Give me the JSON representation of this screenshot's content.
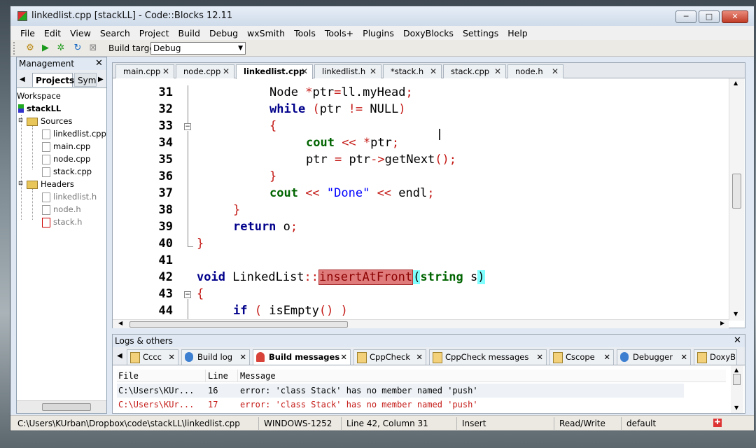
{
  "window": {
    "title": "linkedlist.cpp [stackLL] - Code::Blocks 12.11",
    "minimize": "─",
    "maximize": "□",
    "close": "✕"
  },
  "menu": [
    "File",
    "Edit",
    "View",
    "Search",
    "Project",
    "Build",
    "Debug",
    "wxSmith",
    "Tools",
    "Tools+",
    "Plugins",
    "DoxyBlocks",
    "Settings",
    "Help"
  ],
  "toolbar": {
    "build_target_label": "Build target:",
    "build_target_value": "Debug"
  },
  "management": {
    "title": "Management",
    "tabs": [
      "Projects",
      "Sym"
    ],
    "workspace": "Workspace",
    "project": "stackLL",
    "sources_folder": "Sources",
    "sources": [
      "linkedlist.cpp",
      "main.cpp",
      "node.cpp",
      "stack.cpp"
    ],
    "headers_folder": "Headers",
    "headers": [
      "linkedlist.h",
      "node.h",
      "stack.h"
    ]
  },
  "editor": {
    "tabs": [
      "main.cpp",
      "node.cpp",
      "linkedlist.cpp",
      "linkedlist.h",
      "*stack.h",
      "stack.cpp",
      "node.h"
    ],
    "active_tab": "linkedlist.cpp",
    "line_numbers": [
      "31",
      "32",
      "33",
      "34",
      "35",
      "36",
      "37",
      "38",
      "39",
      "40",
      "41",
      "42",
      "43",
      "44"
    ],
    "code": {
      "l31_a": "Node ",
      "l31_b": "*",
      "l31_c": "ptr",
      "l31_d": "=",
      "l31_e": "ll.myHead",
      "l31_f": ";",
      "l32_kw": "while",
      "l32_b": " ",
      "l32_p1": "(",
      "l32_c": "ptr ",
      "l32_op": "!=",
      "l32_d": " NULL",
      "l32_p2": ")",
      "l33": "{",
      "l34_kw": "cout",
      "l34_op": " << *",
      "l34_c": "ptr",
      "l34_s": ";",
      "l35_a": "ptr ",
      "l35_op": "=",
      "l35_b": " ptr",
      "l35_op2": "->",
      "l35_c": "getNext",
      "l35_d": "();",
      "l36": "}",
      "l37_kw": "cout",
      "l37_op": " << ",
      "l37_str": "\"Done\"",
      "l37_op2": " << ",
      "l37_c": "endl",
      "l37_d": ";",
      "l38": "}",
      "l39_kw": "return",
      "l39_c": " o",
      "l39_d": ";",
      "l40": "}",
      "l42_kw": "void",
      "l42_a": " LinkedList",
      "l42_op": "::",
      "l42_fn": "insertAtFront",
      "l42_p1": "(",
      "l42_kw2": "string",
      "l42_b": " s",
      "l42_p2": ")",
      "l43": "{",
      "l44_kw": "if",
      "l44_a": " ",
      "l44_p1": "(",
      "l44_b": " isEmpty",
      "l44_c": "()",
      "l44_d": " ",
      "l44_p2": ")"
    }
  },
  "logs": {
    "title": "Logs & others",
    "tabs": [
      "Cccc",
      "Build log",
      "Build messages",
      "CppCheck",
      "CppCheck messages",
      "Cscope",
      "Debugger",
      "DoxyBlo"
    ],
    "active_tab": "Build messages",
    "columns": [
      "File",
      "Line",
      "Message"
    ],
    "rows": [
      {
        "file": "C:\\Users\\KUr...",
        "line": "16",
        "message": "error: 'class Stack' has no member named 'push'"
      },
      {
        "file": "C:\\Users\\KUr...",
        "line": "17",
        "message": "error: 'class Stack' has no member named 'push'"
      }
    ]
  },
  "status": {
    "path": "C:\\Users\\KUrban\\Dropbox\\code\\stackLL\\linkedlist.cpp",
    "encoding": "WINDOWS-1252",
    "position": "Line 42, Column 31",
    "mode": "Insert",
    "access": "Read/Write",
    "theme": "default"
  },
  "colors": {
    "keyword": "#00008b",
    "keyword_green": "#006400",
    "operator": "#c41a16",
    "string": "#0000ff",
    "highlight": "#e07b7b"
  }
}
